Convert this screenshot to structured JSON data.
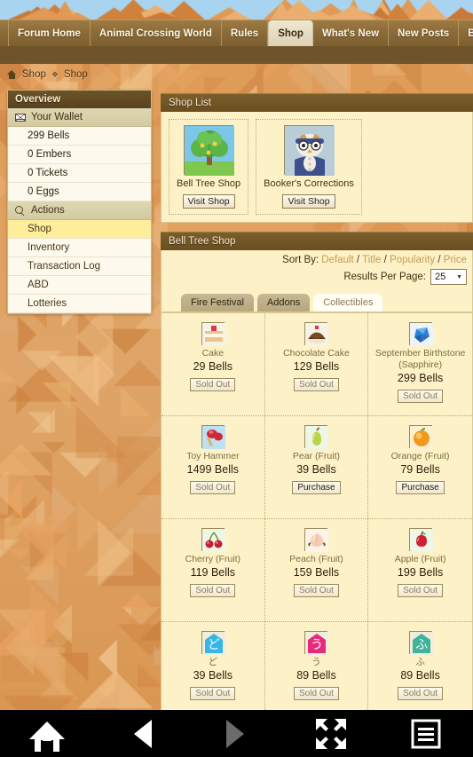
{
  "nav": {
    "tabs": [
      {
        "label": "Forum Home",
        "active": false
      },
      {
        "label": "Animal Crossing World",
        "active": false
      },
      {
        "label": "Rules",
        "active": false
      },
      {
        "label": "Shop",
        "active": true
      },
      {
        "label": "What's New",
        "active": false
      },
      {
        "label": "New Posts",
        "active": false
      },
      {
        "label": "Blog Tree",
        "active": false
      }
    ]
  },
  "breadcrumb": {
    "home_icon": "home-icon",
    "items": [
      "Shop",
      "Shop"
    ],
    "separator": "❖"
  },
  "sidebar": {
    "header": "Overview",
    "wallet": {
      "icon": "envelope-icon",
      "label": "Your Wallet",
      "entries": [
        "299 Bells",
        "0 Embers",
        "0 Tickets",
        "0 Eggs"
      ]
    },
    "actions": {
      "icon": "magnifier-icon",
      "label": "Actions",
      "entries": [
        {
          "label": "Shop",
          "active": true
        },
        {
          "label": "Inventory",
          "active": false
        },
        {
          "label": "Transaction Log",
          "active": false
        },
        {
          "label": "ABD",
          "active": false
        },
        {
          "label": "Lotteries",
          "active": false
        }
      ]
    }
  },
  "shop_list": {
    "title": "Shop List",
    "shops": [
      {
        "name": "Bell Tree Shop",
        "button": "Visit Shop",
        "thumb": "bell-tree"
      },
      {
        "name": "Booker's Corrections",
        "button": "Visit Shop",
        "thumb": "booker"
      }
    ]
  },
  "shop": {
    "title": "Bell Tree Shop",
    "sort": {
      "label": "Sort By:",
      "options": [
        "Default",
        "Title",
        "Popularity",
        "Price"
      ],
      "separator": "/"
    },
    "results_per_page": {
      "label": "Results Per Page:",
      "value": "25",
      "caret": "chevron-down-icon"
    },
    "tabs": [
      {
        "label": "Fire Festival",
        "active": false
      },
      {
        "label": "Addons",
        "active": false
      },
      {
        "label": "Collectibles",
        "active": true
      }
    ],
    "items": [
      {
        "name": "Cake",
        "price": "29 Bells",
        "action": "Sold Out",
        "sold_out": true,
        "icon": "cake"
      },
      {
        "name": "Chocolate Cake",
        "price": "129 Bells",
        "action": "Sold Out",
        "sold_out": true,
        "icon": "choc-cake"
      },
      {
        "name": "September Birthstone (Sapphire)",
        "price": "299 Bells",
        "action": "Sold Out",
        "sold_out": true,
        "icon": "sapphire"
      },
      {
        "name": "Toy Hammer",
        "price": "1499 Bells",
        "action": "Sold Out",
        "sold_out": true,
        "icon": "hammer"
      },
      {
        "name": "Pear (Fruit)",
        "price": "39 Bells",
        "action": "Purchase",
        "sold_out": false,
        "icon": "pear"
      },
      {
        "name": "Orange (Fruit)",
        "price": "79 Bells",
        "action": "Purchase",
        "sold_out": false,
        "icon": "orange"
      },
      {
        "name": "Cherry (Fruit)",
        "price": "119 Bells",
        "action": "Sold Out",
        "sold_out": true,
        "icon": "cherry"
      },
      {
        "name": "Peach (Fruit)",
        "price": "159 Bells",
        "action": "Sold Out",
        "sold_out": true,
        "icon": "peach"
      },
      {
        "name": "Apple (Fruit)",
        "price": "199 Bells",
        "action": "Sold Out",
        "sold_out": true,
        "icon": "apple"
      },
      {
        "name": "ど",
        "price": "39 Bells",
        "action": "Sold Out",
        "sold_out": true,
        "icon": "kana-do"
      },
      {
        "name": "う",
        "price": "89 Bells",
        "action": "Sold Out",
        "sold_out": true,
        "icon": "kana-u"
      },
      {
        "name": "ふ",
        "price": "89 Bells",
        "action": "Sold Out",
        "sold_out": true,
        "icon": "kana-fu"
      }
    ]
  },
  "toolbar": {
    "buttons": [
      {
        "name": "home-icon",
        "label": "Home"
      },
      {
        "name": "back-icon",
        "label": "Back"
      },
      {
        "name": "forward-icon",
        "label": "Forward"
      },
      {
        "name": "fullscreen-icon",
        "label": "Fullscreen"
      },
      {
        "name": "menu-icon",
        "label": "Menu"
      }
    ]
  },
  "colors": {
    "nav_bar": "#8a6a38",
    "panel_head": "#6a4e20",
    "panel_body": "#fdf2c7",
    "active_row": "#fcee9a",
    "link": "#c79a52",
    "background": "#e8a860"
  }
}
